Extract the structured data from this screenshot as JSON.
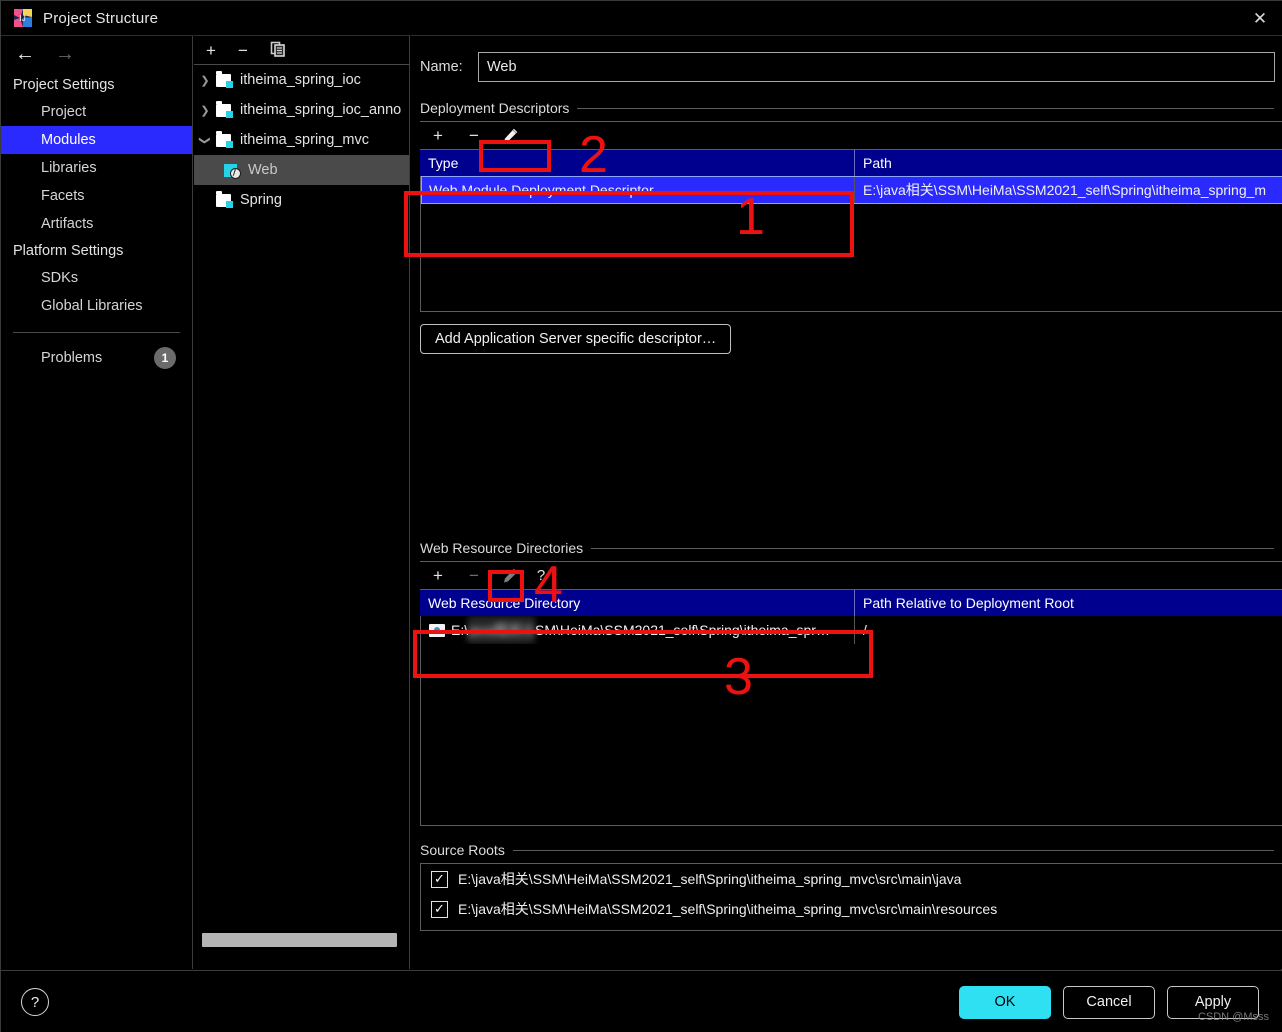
{
  "window": {
    "title": "Project Structure",
    "app_icon": "intellij-idea-logo",
    "close_label": "✕"
  },
  "sidebar": {
    "back_label": "←",
    "forward_label": "→",
    "groups": [
      {
        "label": "Project Settings",
        "items": [
          "Project",
          "Modules",
          "Libraries",
          "Facets",
          "Artifacts"
        ]
      },
      {
        "label": "Platform Settings",
        "items": [
          "SDKs",
          "Global Libraries"
        ]
      }
    ],
    "selected_item": "Modules",
    "problems": {
      "label": "Problems",
      "count": "1"
    }
  },
  "tree": {
    "toolbar": {
      "add": "+",
      "remove": "−",
      "copy": "copy-icon"
    },
    "nodes": [
      {
        "label": "itheima_spring_ioc",
        "twisty": "❯",
        "icon": "module-icon",
        "indent": 0,
        "selected": false
      },
      {
        "label": "itheima_spring_ioc_anno",
        "twisty": "❯",
        "icon": "module-icon",
        "indent": 0,
        "selected": false
      },
      {
        "label": "itheima_spring_mvc",
        "twisty": "❯",
        "icon": "module-icon",
        "indent": 0,
        "selected": false,
        "expanded": true
      },
      {
        "label": "Web",
        "twisty": "",
        "icon": "web-facet-icon",
        "indent": 1,
        "selected": true
      },
      {
        "label": "Spring",
        "twisty": "",
        "icon": "module-icon",
        "indent": 0,
        "selected": false
      }
    ]
  },
  "main": {
    "name": {
      "label": "Name:",
      "value": "Web",
      "placeholder": ""
    },
    "deployment_descriptors": {
      "title": "Deployment Descriptors",
      "toolbar": {
        "add": "+",
        "remove": "−",
        "edit": "pencil-icon"
      },
      "columns": [
        "Type",
        "Path"
      ],
      "rows": [
        {
          "type": "Web Module Deployment Descriptor",
          "path": "E:\\java相关\\SSM\\HeiMa\\SSM2021_self\\Spring\\itheima_spring_m",
          "selected": true
        }
      ],
      "add_button": "Add Application Server specific descriptor…"
    },
    "web_resource_directories": {
      "title": "Web Resource Directories",
      "toolbar": {
        "add": "+",
        "remove": "−",
        "edit": "pencil-icon",
        "help": "?"
      },
      "columns": [
        "Web Resource Directory",
        "Path Relative to Deployment Root"
      ],
      "rows": [
        {
          "directory_prefix": "E:\\",
          "directory_redacted": "java相关\\S",
          "directory_suffix": "SM\\HeiMa\\SSM2021_self\\Spring\\itheima_spr…",
          "relative_path": "/",
          "selected": false
        }
      ]
    },
    "source_roots": {
      "title": "Source Roots",
      "rows": [
        {
          "checked": true,
          "path": "E:\\java相关\\SSM\\HeiMa\\SSM2021_self\\Spring\\itheima_spring_mvc\\src\\main\\java"
        },
        {
          "checked": true,
          "path": "E:\\java相关\\SSM\\HeiMa\\SSM2021_self\\Spring\\itheima_spring_mvc\\src\\main\\resources"
        }
      ]
    }
  },
  "footer": {
    "help": "?",
    "ok": "OK",
    "cancel": "Cancel",
    "apply": "Apply"
  },
  "annotations": {
    "markers": [
      "1",
      "2",
      "3",
      "4"
    ]
  },
  "watermark": "CSDN @Msss",
  "colors": {
    "selection_blue": "#2a2aff",
    "header_blue": "#00008f",
    "accent_cyan": "#2ee0f2",
    "annotation_red": "#ee1111",
    "module_badge": "#26d2e8"
  }
}
